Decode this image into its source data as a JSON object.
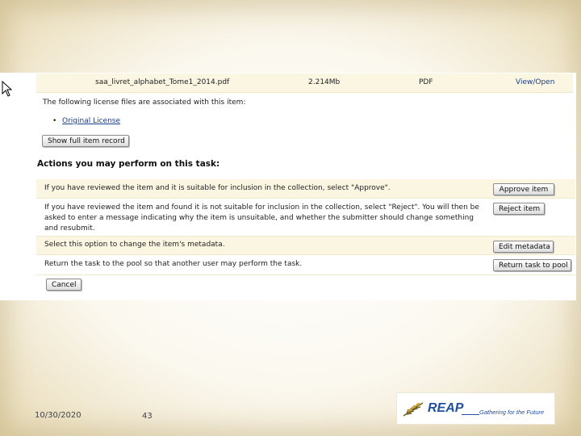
{
  "file_row": {
    "filename": "saa_livret_alphabet_Tome1_2014.pdf",
    "size": "2.214Mb",
    "format": "PDF",
    "view_label": "View/Open"
  },
  "license": {
    "intro": "The following license files are associated with this item:",
    "bullet": "•",
    "link_label": "Original License"
  },
  "show_full_record_label": "Show full item record",
  "actions": {
    "heading": "Actions you may perform on this task:",
    "rows": [
      {
        "text": "If you have reviewed the item and it is suitable for inclusion in the collection, select \"Approve\".",
        "button": "Approve item"
      },
      {
        "text": "If you have reviewed the item and found it is not suitable for inclusion in the collection, select \"Reject\". You will then be asked to enter a message indicating why the item is unsuitable, and whether the submitter should change something and resubmit.",
        "button": "Reject item"
      },
      {
        "text": "Select this option to change the item's metadata.",
        "button": "Edit metadata"
      },
      {
        "text": "Return the task to the pool so that another user may perform the task.",
        "button": "Return task to pool"
      }
    ],
    "cancel_label": "Cancel"
  },
  "footer": {
    "date": "10/30/2020",
    "page_number": "43"
  },
  "logo": {
    "word": "REAP",
    "tagline": "Gathering for the Future"
  },
  "colors": {
    "row_highlight": "#fbf6e2",
    "link": "#1a3a8a",
    "logo_blue": "#1f4f9e"
  }
}
